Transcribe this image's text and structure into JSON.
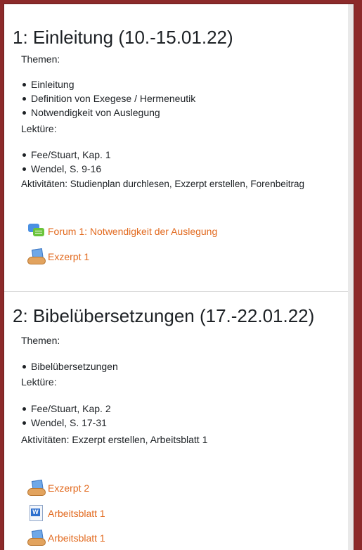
{
  "sections": [
    {
      "title": "1: Einleitung (10.-15.01.22)",
      "themen_label": "Themen:",
      "themen": [
        "Einleitung",
        "Definition von Exegese / Hermeneutik",
        "Notwendigkeit von Auslegung"
      ],
      "lektuere_label": "Lektüre:",
      "lektuere": [
        "Fee/Stuart, Kap. 1",
        "Wendel, S. 9-16"
      ],
      "aktivitaeten": "Aktivitäten: Studienplan durchlesen, Exzerpt erstellen, Forenbeitrag",
      "activities": [
        {
          "label": "Forum 1: Notwendigkeit der Auslegung",
          "icon": "forum-icon"
        },
        {
          "label": "Exzerpt 1",
          "icon": "assignment-icon"
        }
      ]
    },
    {
      "title": "2: Bibelübersetzungen (17.-22.01.22)",
      "themen_label": "Themen:",
      "themen": [
        "Bibelübersetzungen"
      ],
      "lektuere_label": "Lektüre:",
      "lektuere": [
        "Fee/Stuart, Kap. 2",
        "Wendel, S. 17-31"
      ],
      "aktivitaeten": "Aktivitäten: Exzerpt erstellen, Arbeitsblatt 1",
      "activities": [
        {
          "label": "Exzerpt 2",
          "icon": "assignment-icon"
        },
        {
          "label": "Arbeitsblatt 1",
          "icon": "word-document-icon"
        },
        {
          "label": "Arbeitsblatt 1",
          "icon": "assignment-icon"
        }
      ]
    }
  ],
  "colors": {
    "link": "#e26a1f",
    "text": "#1d2125",
    "border": "#8c2a2a"
  }
}
